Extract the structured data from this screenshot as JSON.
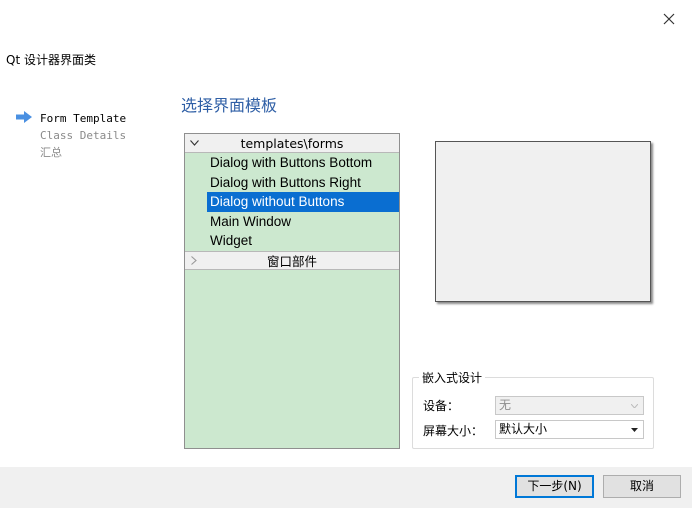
{
  "window": {
    "wizard_title": "Qt 设计器界面类",
    "close_glyph": "×"
  },
  "steps": [
    {
      "label": "Form Template",
      "active": true
    },
    {
      "label": "Class Details",
      "active": false
    },
    {
      "label": "汇总",
      "active": false
    }
  ],
  "page": {
    "section_title": "选择界面模板"
  },
  "tree": {
    "group1_header": "templates\\forms",
    "group1_items": [
      "Dialog with Buttons Bottom",
      "Dialog with Buttons Right",
      "Dialog without Buttons",
      "Main Window",
      "Widget"
    ],
    "selected_item": "Dialog without Buttons",
    "group2_header": "窗口部件"
  },
  "embed": {
    "legend": "嵌入式设计",
    "device_label": "设备：",
    "device_value": "无",
    "screen_label": "屏幕大小：",
    "screen_value": "默认大小"
  },
  "buttons": {
    "next": "下一步(N)",
    "cancel": "取消"
  },
  "colors": {
    "accent": "#0a6ed1",
    "list_bg": "#cce8cf",
    "title_blue": "#2f5fa6",
    "step_arrow": "#4a90e2"
  }
}
